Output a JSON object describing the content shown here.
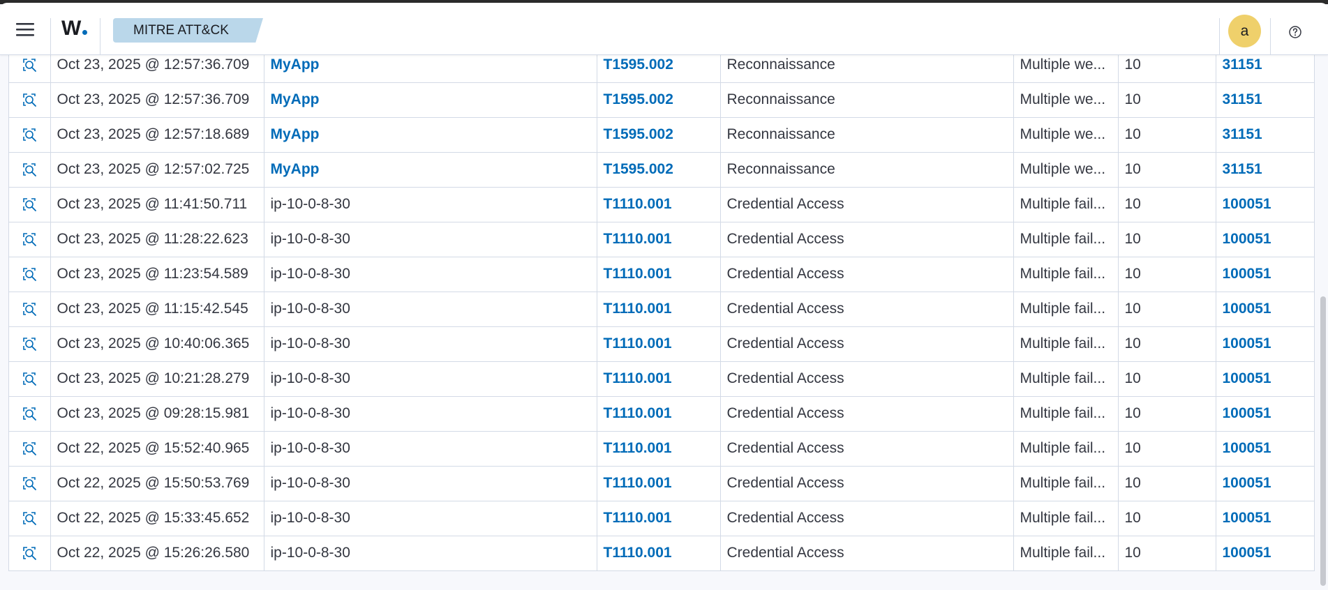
{
  "header": {
    "logo_text": "W",
    "breadcrumb": "MITRE ATT&CK",
    "avatar_initial": "a",
    "accent_color": "#006bb8"
  },
  "table": {
    "rows": [
      {
        "time": "Oct 23, 2025 @ 12:57:36.709",
        "agent": "MyApp",
        "agent_link": true,
        "technique": "T1595.002",
        "tactic": "Reconnaissance",
        "description": "Multiple we...",
        "level": "10",
        "rule_id": "31151"
      },
      {
        "time": "Oct 23, 2025 @ 12:57:36.709",
        "agent": "MyApp",
        "agent_link": true,
        "technique": "T1595.002",
        "tactic": "Reconnaissance",
        "description": "Multiple we...",
        "level": "10",
        "rule_id": "31151"
      },
      {
        "time": "Oct 23, 2025 @ 12:57:18.689",
        "agent": "MyApp",
        "agent_link": true,
        "technique": "T1595.002",
        "tactic": "Reconnaissance",
        "description": "Multiple we...",
        "level": "10",
        "rule_id": "31151"
      },
      {
        "time": "Oct 23, 2025 @ 12:57:02.725",
        "agent": "MyApp",
        "agent_link": true,
        "technique": "T1595.002",
        "tactic": "Reconnaissance",
        "description": "Multiple we...",
        "level": "10",
        "rule_id": "31151"
      },
      {
        "time": "Oct 23, 2025 @ 11:41:50.711",
        "agent": "ip-10-0-8-30",
        "agent_link": false,
        "technique": "T1110.001",
        "tactic": "Credential Access",
        "description": "Multiple fail...",
        "level": "10",
        "rule_id": "100051"
      },
      {
        "time": "Oct 23, 2025 @ 11:28:22.623",
        "agent": "ip-10-0-8-30",
        "agent_link": false,
        "technique": "T1110.001",
        "tactic": "Credential Access",
        "description": "Multiple fail...",
        "level": "10",
        "rule_id": "100051"
      },
      {
        "time": "Oct 23, 2025 @ 11:23:54.589",
        "agent": "ip-10-0-8-30",
        "agent_link": false,
        "technique": "T1110.001",
        "tactic": "Credential Access",
        "description": "Multiple fail...",
        "level": "10",
        "rule_id": "100051"
      },
      {
        "time": "Oct 23, 2025 @ 11:15:42.545",
        "agent": "ip-10-0-8-30",
        "agent_link": false,
        "technique": "T1110.001",
        "tactic": "Credential Access",
        "description": "Multiple fail...",
        "level": "10",
        "rule_id": "100051"
      },
      {
        "time": "Oct 23, 2025 @ 10:40:06.365",
        "agent": "ip-10-0-8-30",
        "agent_link": false,
        "technique": "T1110.001",
        "tactic": "Credential Access",
        "description": "Multiple fail...",
        "level": "10",
        "rule_id": "100051"
      },
      {
        "time": "Oct 23, 2025 @ 10:21:28.279",
        "agent": "ip-10-0-8-30",
        "agent_link": false,
        "technique": "T1110.001",
        "tactic": "Credential Access",
        "description": "Multiple fail...",
        "level": "10",
        "rule_id": "100051"
      },
      {
        "time": "Oct 23, 2025 @ 09:28:15.981",
        "agent": "ip-10-0-8-30",
        "agent_link": false,
        "technique": "T1110.001",
        "tactic": "Credential Access",
        "description": "Multiple fail...",
        "level": "10",
        "rule_id": "100051"
      },
      {
        "time": "Oct 22, 2025 @ 15:52:40.965",
        "agent": "ip-10-0-8-30",
        "agent_link": false,
        "technique": "T1110.001",
        "tactic": "Credential Access",
        "description": "Multiple fail...",
        "level": "10",
        "rule_id": "100051"
      },
      {
        "time": "Oct 22, 2025 @ 15:50:53.769",
        "agent": "ip-10-0-8-30",
        "agent_link": false,
        "technique": "T1110.001",
        "tactic": "Credential Access",
        "description": "Multiple fail...",
        "level": "10",
        "rule_id": "100051"
      },
      {
        "time": "Oct 22, 2025 @ 15:33:45.652",
        "agent": "ip-10-0-8-30",
        "agent_link": false,
        "technique": "T1110.001",
        "tactic": "Credential Access",
        "description": "Multiple fail...",
        "level": "10",
        "rule_id": "100051"
      },
      {
        "time": "Oct 22, 2025 @ 15:26:26.580",
        "agent": "ip-10-0-8-30",
        "agent_link": false,
        "technique": "T1110.001",
        "tactic": "Credential Access",
        "description": "Multiple fail...",
        "level": "10",
        "rule_id": "100051"
      }
    ]
  }
}
